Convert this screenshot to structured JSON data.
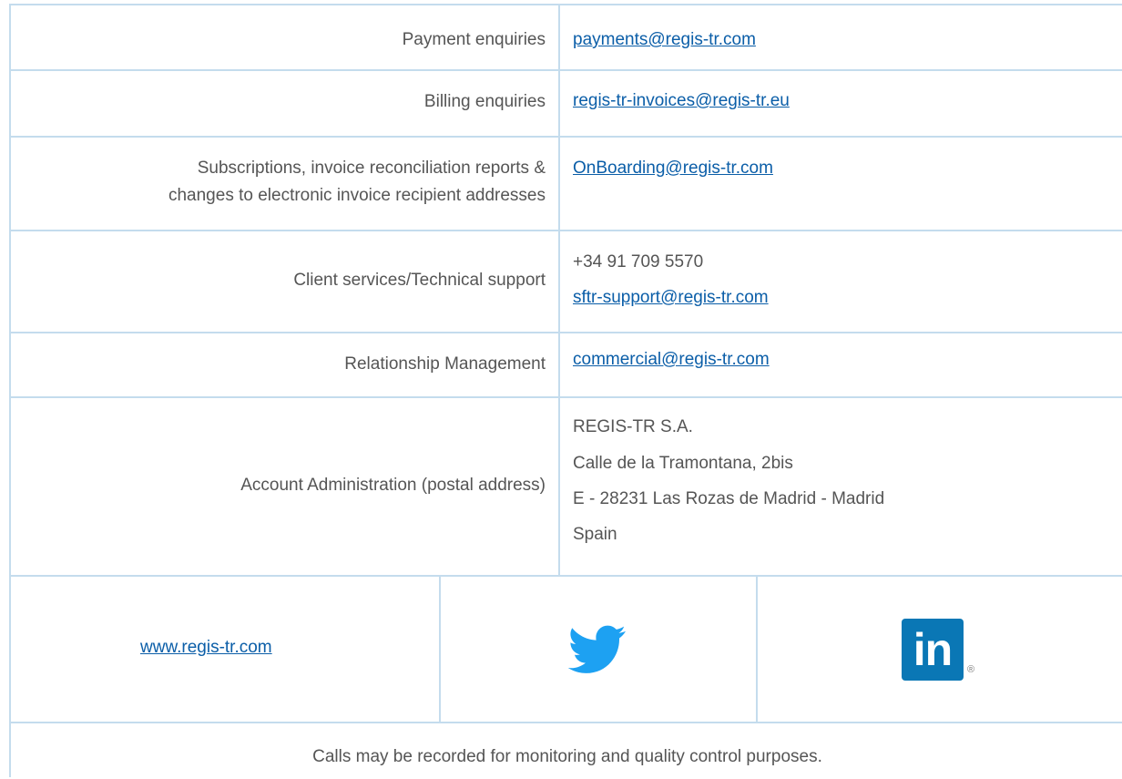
{
  "contacts": {
    "payment": {
      "label": "Payment enquiries",
      "email": "payments@regis-tr.com"
    },
    "billing": {
      "label": "Billing enquiries",
      "email": "regis-tr-invoices@regis-tr.eu"
    },
    "subscriptions": {
      "label_line1": "Subscriptions, invoice reconciliation reports &",
      "label_line2": "changes to electronic invoice recipient addresses",
      "email": "OnBoarding@regis-tr.com"
    },
    "client_services": {
      "label": "Client services/Technical support",
      "phone": "+34 91 709 5570",
      "email": "sftr-support@regis-tr.com"
    },
    "relationship": {
      "label": "Relationship Management",
      "email": "commercial@regis-tr.com"
    },
    "account_admin": {
      "label": "Account Administration (postal address)",
      "address_line1": "REGIS-TR S.A.",
      "address_line2": "Calle de la Tramontana, 2bis",
      "address_line3": "E - 28231 Las Rozas de Madrid - Madrid",
      "address_line4": "Spain"
    }
  },
  "social": {
    "website": "www.regis-tr.com",
    "twitter_icon": "twitter-bird-icon",
    "linkedin_icon": "linkedin-in-icon",
    "linkedin_text": "in",
    "linkedin_registered": "®"
  },
  "footer": {
    "notice": "Calls may be recorded for monitoring and quality control purposes."
  },
  "colors": {
    "border": "#c4dced",
    "link": "#0b5ea8",
    "text": "#555555",
    "twitter": "#1da1f2",
    "linkedin": "#0a77b5"
  }
}
